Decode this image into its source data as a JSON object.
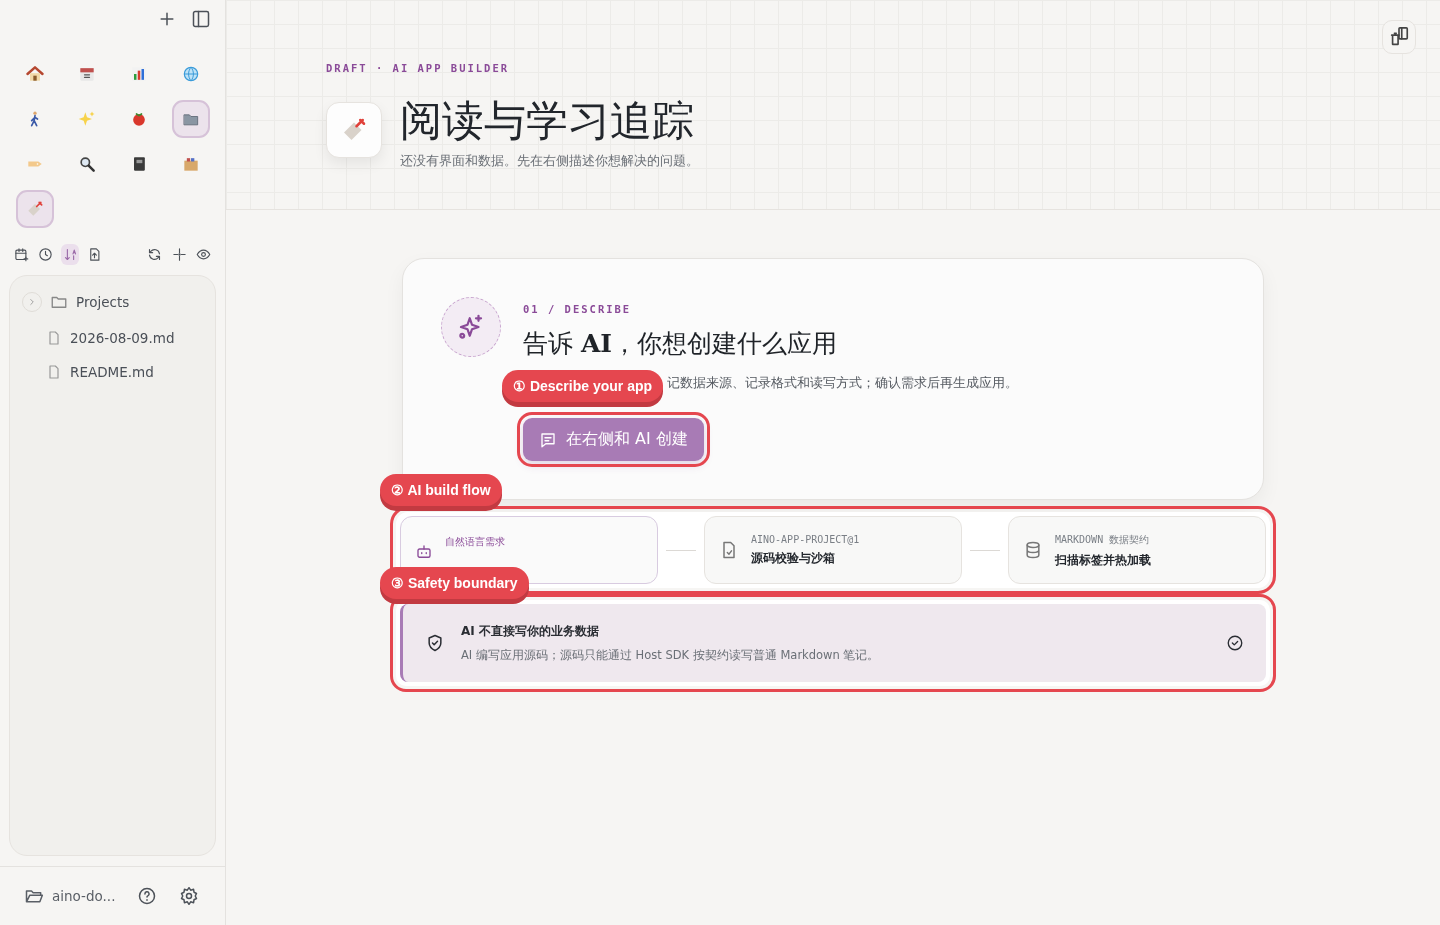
{
  "sidebar": {
    "apps": [
      {
        "selected": false
      },
      {
        "selected": false
      },
      {
        "selected": false
      },
      {
        "selected": false
      },
      {
        "selected": false
      },
      {
        "selected": false
      },
      {
        "selected": false
      },
      {
        "selected": true
      },
      {
        "selected": false
      },
      {
        "selected": false
      },
      {
        "selected": false
      },
      {
        "selected": false
      },
      {
        "selected": true
      }
    ],
    "toolbar": [
      {
        "selected": false
      },
      {
        "selected": false
      },
      {
        "selected": true
      },
      {
        "selected": false
      },
      {
        "selected": false
      },
      {
        "selected": false
      },
      {
        "selected": false
      }
    ],
    "tree": [
      {
        "kind": "folder",
        "label": "Projects",
        "expanded": false
      },
      {
        "kind": "file",
        "label": "2026-08-09.md"
      },
      {
        "kind": "file",
        "label": "README.md"
      }
    ],
    "footer": {
      "workspace": "aino-do..."
    }
  },
  "header": {
    "eyebrow": "DRAFT · AI APP BUILDER",
    "title": "阅读与学习追踪",
    "subtitle": "还没有界面和数据。先在右侧描述你想解决的问题。"
  },
  "describe": {
    "step": "01 / DESCRIBE",
    "title": "告诉 **AI**，你想创建什么应用",
    "description": "记数据来源、记录格式和读写方式；确认需求后再生成应用。",
    "button": {
      "label": "在右侧和 AI 创建",
      "highlighted": true
    }
  },
  "flow": {
    "highlighted": true,
    "steps": [
      {
        "caption": "自然语言需求",
        "selected": true
      },
      {
        "caption": "AINO-APP-PROJECT@1",
        "title": "源码校验与沙箱",
        "selected": false
      },
      {
        "caption": "MARKDOWN 数据契约",
        "title": "扫描标签并热加载",
        "selected": false
      }
    ]
  },
  "safety": {
    "highlighted": true,
    "title": "AI 不直接写你的业务数据",
    "text": "AI 编写应用源码；源码只能通过 Host SDK 按契约读写普通 Markdown 笔记。"
  },
  "annotations": [
    {
      "number": "①",
      "label": "Describe your app"
    },
    {
      "number": "②",
      "label": "AI build flow"
    },
    {
      "number": "③",
      "label": "Safety boundary"
    }
  ]
}
